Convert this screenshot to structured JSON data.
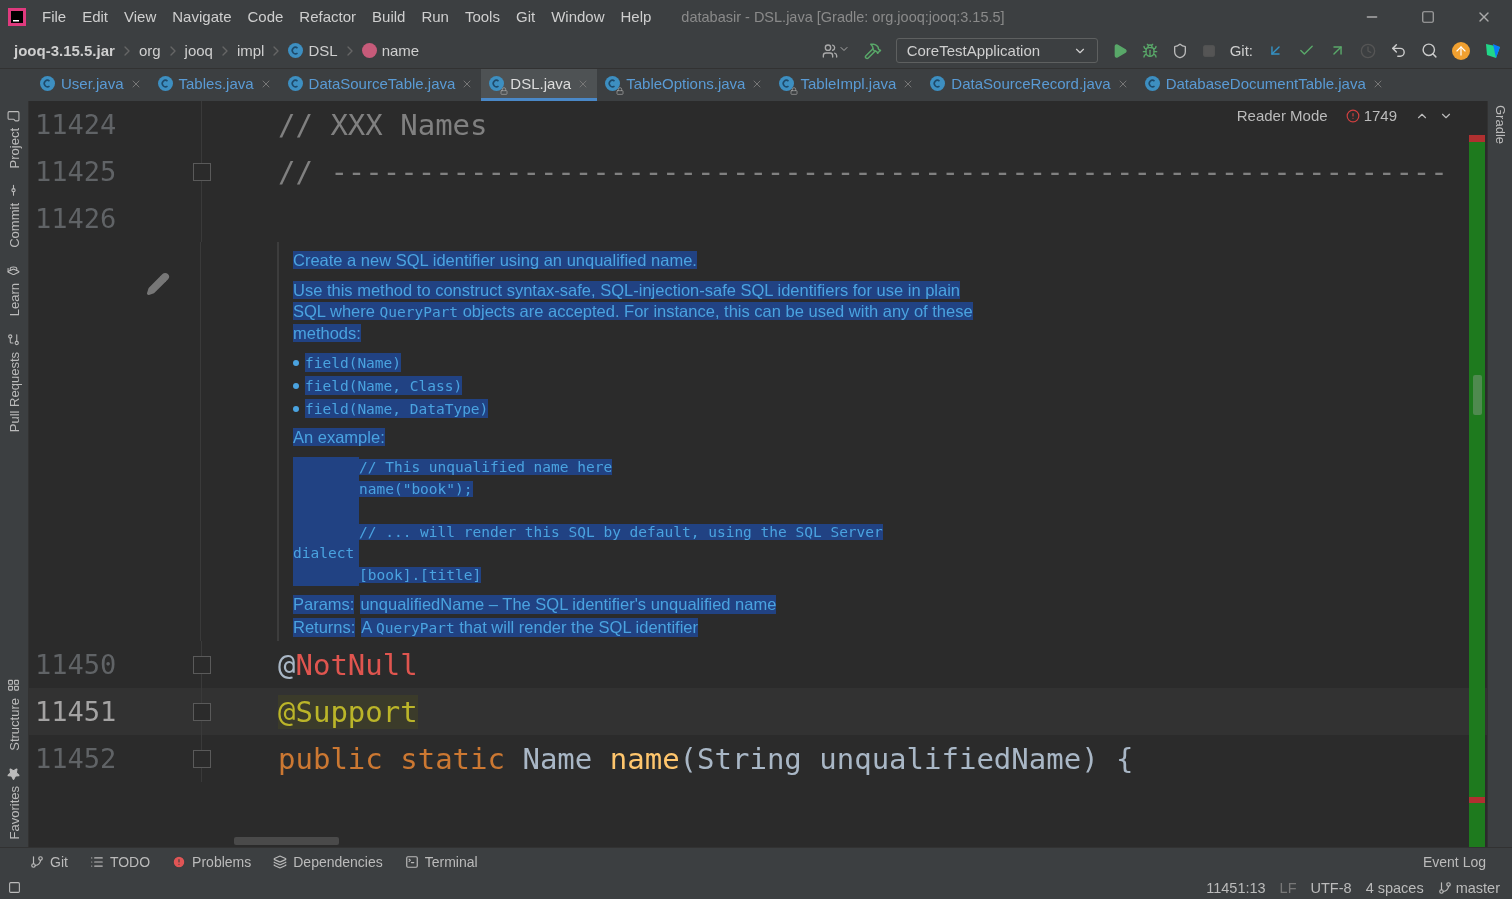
{
  "window": {
    "menu": [
      "File",
      "Edit",
      "View",
      "Navigate",
      "Code",
      "Refactor",
      "Build",
      "Run",
      "Tools",
      "Git",
      "Window",
      "Help"
    ],
    "title": "databasir - DSL.java [Gradle: org.jooq:jooq:3.15.5]"
  },
  "breadcrumb": [
    {
      "text": "jooq-3.15.5.jar",
      "kind": "jar"
    },
    {
      "text": "org",
      "kind": "package"
    },
    {
      "text": "jooq",
      "kind": "package"
    },
    {
      "text": "impl",
      "kind": "package"
    },
    {
      "text": "DSL",
      "kind": "class"
    },
    {
      "text": "name",
      "kind": "method"
    }
  ],
  "toolbar": {
    "run_config": "CoreTestApplication",
    "git_label": "Git:"
  },
  "tabs": [
    {
      "label": "User.java",
      "selected": false,
      "locked": false
    },
    {
      "label": "Tables.java",
      "selected": false,
      "locked": false
    },
    {
      "label": "DataSourceTable.java",
      "selected": false,
      "locked": false
    },
    {
      "label": "DSL.java",
      "selected": true,
      "locked": true
    },
    {
      "label": "TableOptions.java",
      "selected": false,
      "locked": true
    },
    {
      "label": "TableImpl.java",
      "selected": false,
      "locked": true
    },
    {
      "label": "DataSourceRecord.java",
      "selected": false,
      "locked": false
    },
    {
      "label": "DatabaseDocumentTable.java",
      "selected": false,
      "locked": false
    }
  ],
  "left_tools_top": [
    {
      "label": "Project",
      "kind": "folder"
    },
    {
      "label": "Commit",
      "kind": "commit"
    },
    {
      "label": "Learn",
      "kind": "learn"
    },
    {
      "label": "Pull Requests",
      "kind": "pull"
    }
  ],
  "left_tools_bottom": [
    {
      "label": "Structure",
      "kind": "structure"
    },
    {
      "label": "Favorites",
      "kind": "star"
    }
  ],
  "right_tools": [
    "Gradle"
  ],
  "editor": {
    "reader_mode": "Reader Mode",
    "problems": "1749",
    "lines_before": [
      {
        "number": "11424",
        "current": false,
        "fold": false,
        "tokens": [
          {
            "kind": "comment",
            "text": "// XXX Names"
          }
        ]
      },
      {
        "number": "11425",
        "current": false,
        "fold": true,
        "tokens": [
          {
            "kind": "comment",
            "text": "// ----------------------------------------------------------------"
          }
        ]
      },
      {
        "number": "11426",
        "current": false,
        "fold": false
      }
    ],
    "doc": {
      "summary": "Create a new SQL identifier using an unqualified name.",
      "description": [
        {
          "kind": "text",
          "text": "Use this method to construct syntax-safe, SQL-injection-safe SQL identifiers for use in plain SQL where "
        },
        {
          "kind": "code",
          "text": "QueryPart"
        },
        {
          "kind": "text",
          "text": " objects are accepted. For instance, this can be used with any of these methods:"
        }
      ],
      "list": [
        "field(Name)",
        "field(Name, Class)",
        "field(Name, DataType)"
      ],
      "example_label": "An example:",
      "example": [
        {
          "kind": "code",
          "text": "// This unqualified name here"
        },
        {
          "kind": "code",
          "text": "name(\"book\");"
        },
        {
          "kind": "blank"
        },
        {
          "kind": "code",
          "text": "// ... will render this SQL by default, using the SQL Server dialect"
        },
        {
          "kind": "code",
          "text": "[book].[title]"
        }
      ],
      "tags": [
        {
          "label": "Params:",
          "parts": [
            {
              "kind": "text",
              "text": "unqualifiedName – The SQL identifier's unqualified name"
            }
          ]
        },
        {
          "label": "Returns:",
          "parts": [
            {
              "kind": "text",
              "text": "A "
            },
            {
              "kind": "code",
              "text": "QueryPart"
            },
            {
              "kind": "text",
              "text": " that will render the SQL identifier"
            }
          ]
        }
      ]
    },
    "lines_after": [
      {
        "number": "11450",
        "current": false,
        "fold": true,
        "tokens": [
          {
            "kind": "plain",
            "text": "@"
          },
          {
            "kind": "error",
            "text": "NotNull"
          }
        ]
      },
      {
        "number": "11451",
        "current": true,
        "fold": true,
        "tokens": [
          {
            "kind": "annotation",
            "text": "@Support"
          }
        ]
      },
      {
        "number": "11452",
        "current": false,
        "fold": true,
        "tokens": [
          {
            "kind": "keyword",
            "text": "public static "
          },
          {
            "kind": "plain",
            "text": "Name "
          },
          {
            "kind": "method",
            "text": "name"
          },
          {
            "kind": "plain",
            "text": "(String unqualifiedName) {"
          }
        ]
      }
    ]
  },
  "bottom_tools": [
    {
      "label": "Git",
      "kind": "git"
    },
    {
      "label": "TODO",
      "kind": "todo"
    },
    {
      "label": "Problems",
      "kind": "problems"
    },
    {
      "label": "Dependencies",
      "kind": "deps"
    },
    {
      "label": "Terminal",
      "kind": "terminal"
    }
  ],
  "event_log": "Event Log",
  "status": {
    "position": "11451:13",
    "line_sep": "LF",
    "encoding": "UTF-8",
    "indent": "4 spaces",
    "branch": "master"
  }
}
